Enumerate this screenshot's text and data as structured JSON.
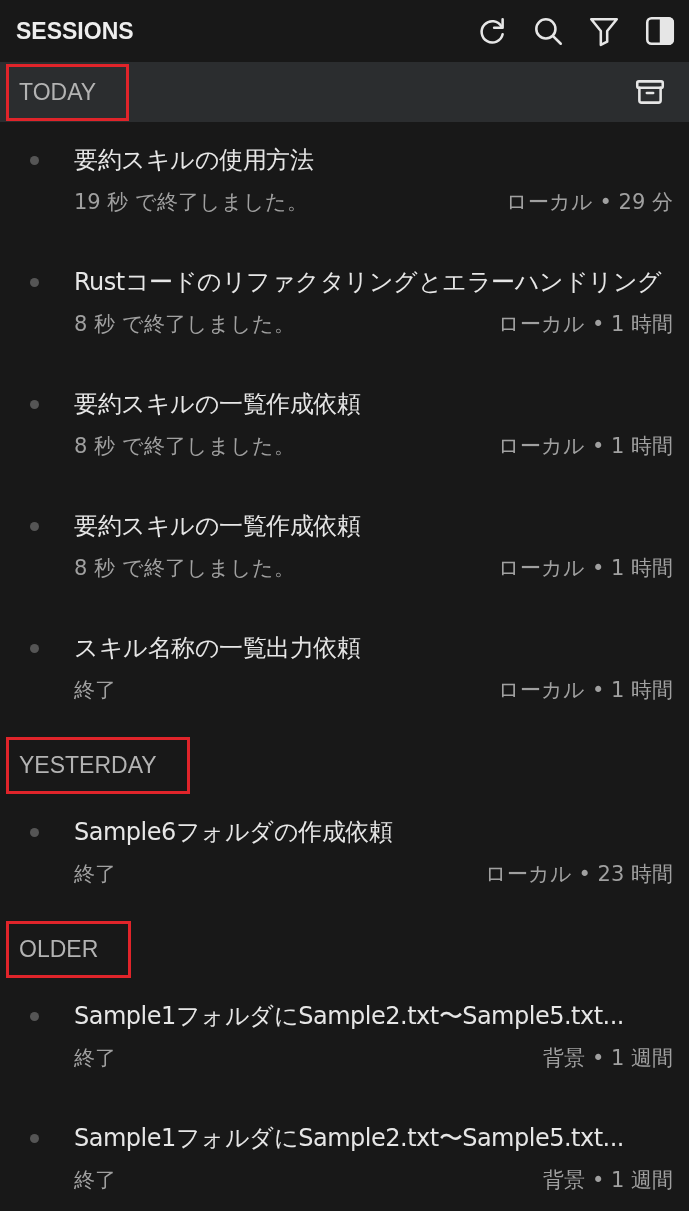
{
  "panel": {
    "title": "SESSIONS"
  },
  "sections": [
    {
      "label": "TODAY",
      "hovered": true,
      "marked": true,
      "items": [
        {
          "title": "要約スキルの使用方法",
          "status": "19 秒 で終了しました。",
          "meta": "ローカル • 29 分"
        },
        {
          "title": "Rustコードのリファクタリングとエラーハンドリング",
          "status": "8 秒 で終了しました。",
          "meta": "ローカル • 1 時間"
        },
        {
          "title": "要約スキルの一覧作成依頼",
          "status": "8 秒 で終了しました。",
          "meta": "ローカル • 1 時間"
        },
        {
          "title": "要約スキルの一覧作成依頼",
          "status": "8 秒 で終了しました。",
          "meta": "ローカル • 1 時間"
        },
        {
          "title": "スキル名称の一覧出力依頼",
          "status": "終了",
          "meta": "ローカル • 1 時間"
        }
      ]
    },
    {
      "label": "YESTERDAY",
      "hovered": false,
      "marked": true,
      "items": [
        {
          "title": "Sample6フォルダの作成依頼",
          "status": "終了",
          "meta": "ローカル • 23 時間"
        }
      ]
    },
    {
      "label": "OLDER",
      "hovered": false,
      "marked": true,
      "items": [
        {
          "title": "Sample1フォルダにSample2.txt〜Sample5.txt...",
          "status": "終了",
          "meta": "背景 • 1 週間"
        },
        {
          "title": "Sample1フォルダにSample2.txt〜Sample5.txt...",
          "status": "終了",
          "meta": "背景 • 1 週間"
        }
      ]
    }
  ]
}
